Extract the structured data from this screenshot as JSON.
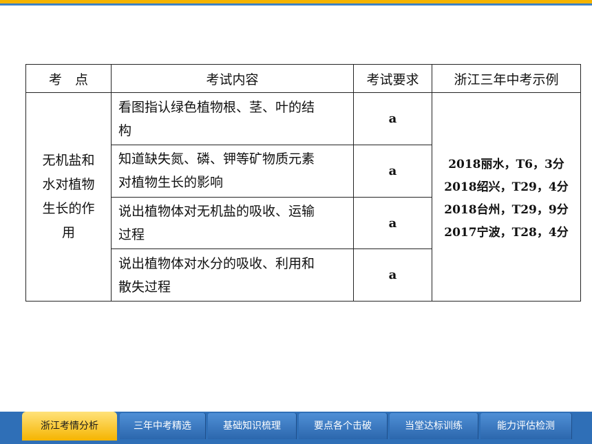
{
  "table": {
    "headers": [
      "考　点",
      "考试内容",
      "考试要求",
      "浙江三年中考示例"
    ],
    "topic_lines": [
      "无机盐和",
      "水对植物",
      "生长的作",
      "用"
    ],
    "rows": [
      {
        "content_lines": [
          "看图指认绿色植物根、茎、叶的结",
          "构"
        ],
        "requirement": "a"
      },
      {
        "content_lines": [
          "知道缺失氮、磷、钾等矿物质元素",
          "对植物生长的影响"
        ],
        "requirement": "a"
      },
      {
        "content_lines": [
          "说出植物体对无机盐的吸收、运输",
          "过程"
        ],
        "requirement": "a"
      },
      {
        "content_lines": [
          "说出植物体对水分的吸收、利用和",
          "散失过程"
        ],
        "requirement": "a"
      }
    ],
    "examples": [
      "2018丽水，T6，3分",
      "2018绍兴，T29，4分",
      "2018台州，T29，9分",
      "2017宁波，T28，4分"
    ]
  },
  "nav": {
    "tabs": [
      "浙江考情分析",
      "三年中考精选",
      "基础知识梳理",
      "要点各个击破",
      "当堂达标训练",
      "能力评估检测"
    ],
    "active_index": 0
  },
  "colors": {
    "accent_yellow": "#f5b400",
    "nav_blue": "#2f6fb7"
  }
}
